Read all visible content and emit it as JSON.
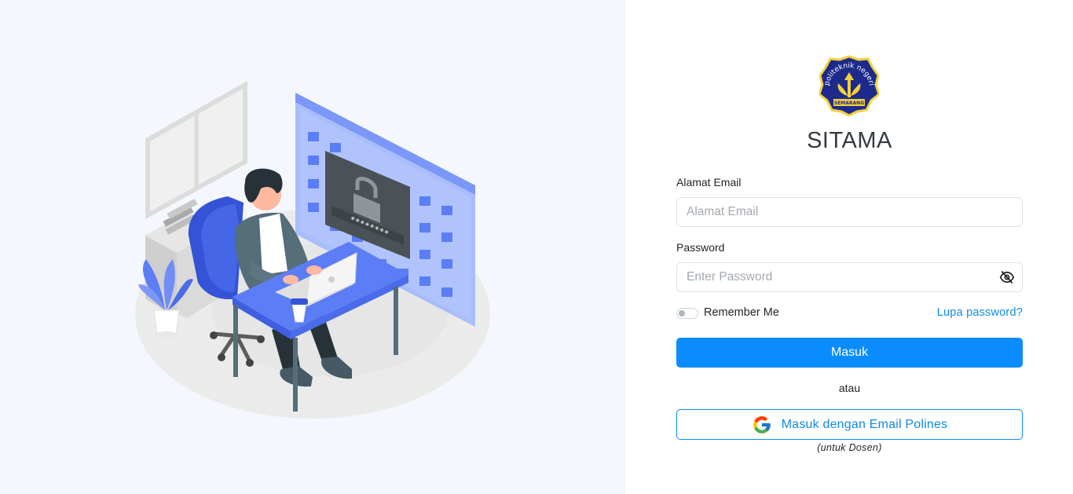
{
  "app": {
    "title": "SITAMA",
    "logo": {
      "arc_text": "politeknik negeri",
      "banner_text": "SEMARANG",
      "colors": {
        "navy": "#1d2a8c",
        "gold": "#f2d03b"
      }
    }
  },
  "login_form": {
    "email_label": "Alamat Email",
    "email_placeholder": "Alamat Email",
    "email_value": "",
    "password_label": "Password",
    "password_placeholder": "Enter Password",
    "password_value": "",
    "password_toggle_icon": "eye-slash-icon",
    "remember_label": "Remember Me",
    "remember_checked": false,
    "forgot_link": "Lupa password?",
    "submit_label": "Masuk",
    "separator_text": "atau",
    "google_button_label": "Masuk dengan Email Polines",
    "google_icon": "google-g-icon",
    "google_note": "(untuk Dosen)"
  },
  "illustration": {
    "screen_password_mask": "********",
    "subject": "person-at-desk-with-laptop-and-locked-screen"
  },
  "theme": {
    "primary": "#0a8cff",
    "link": "#0d8ae6",
    "left_bg": "#f5f7fe",
    "illustration_blue": "#5b7df5"
  }
}
